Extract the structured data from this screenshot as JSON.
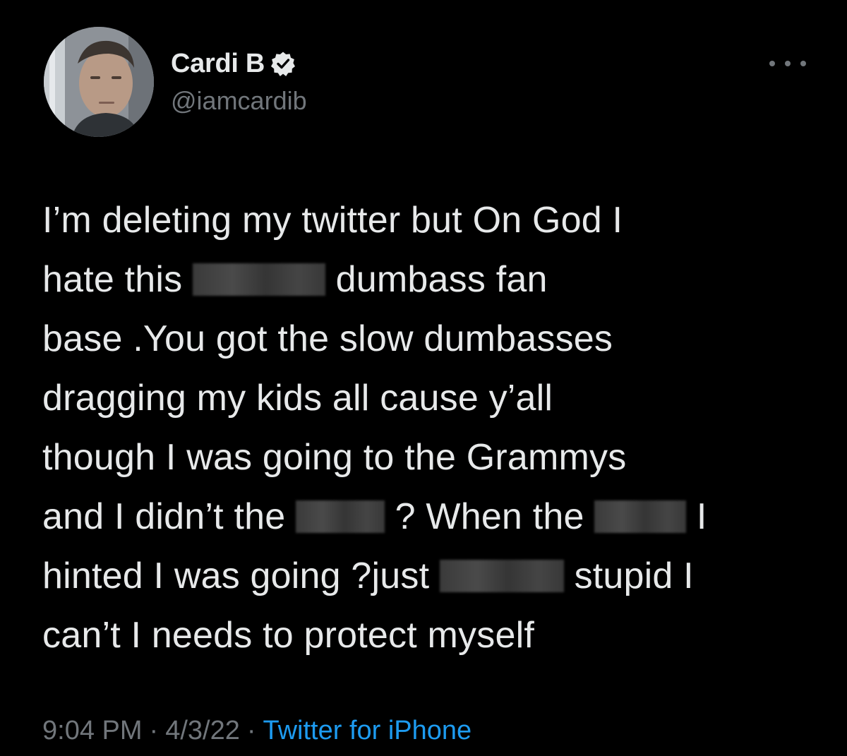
{
  "author": {
    "name": "Cardi B",
    "handle": "@iamcardib",
    "verified": true,
    "avatar_icon": "profile-photo"
  },
  "menu": {
    "more_icon": "more-options-icon"
  },
  "tweet": {
    "lines": [
      {
        "segments": [
          {
            "text": "I’m deleting my twitter but On God I"
          }
        ]
      },
      {
        "segments": [
          {
            "text": "hate this "
          },
          {
            "redacted": true
          },
          {
            "text": " dumbass fan"
          }
        ]
      },
      {
        "segments": [
          {
            "text": "base .You got the slow dumbasses"
          }
        ]
      },
      {
        "segments": [
          {
            "text": "dragging my kids all cause y’all"
          }
        ]
      },
      {
        "segments": [
          {
            "text": "though I was going to the Grammys"
          }
        ]
      },
      {
        "segments": [
          {
            "text": "and I didn’t the "
          },
          {
            "redacted": true
          },
          {
            "text": " ? When the "
          },
          {
            "redacted": true
          },
          {
            "text": " I"
          }
        ]
      },
      {
        "segments": [
          {
            "text": "hinted I was going ?just "
          },
          {
            "redacted": true
          },
          {
            "text": " stupid I"
          }
        ]
      },
      {
        "segments": [
          {
            "text": "can’t I needs to protect myself"
          }
        ]
      }
    ]
  },
  "meta": {
    "time": "9:04 PM",
    "separator": "·",
    "date": "4/3/22",
    "source": "Twitter for iPhone"
  },
  "colors": {
    "background": "#000000",
    "text": "#e7e9ea",
    "secondary": "#71767b",
    "link": "#1d9bf0"
  }
}
